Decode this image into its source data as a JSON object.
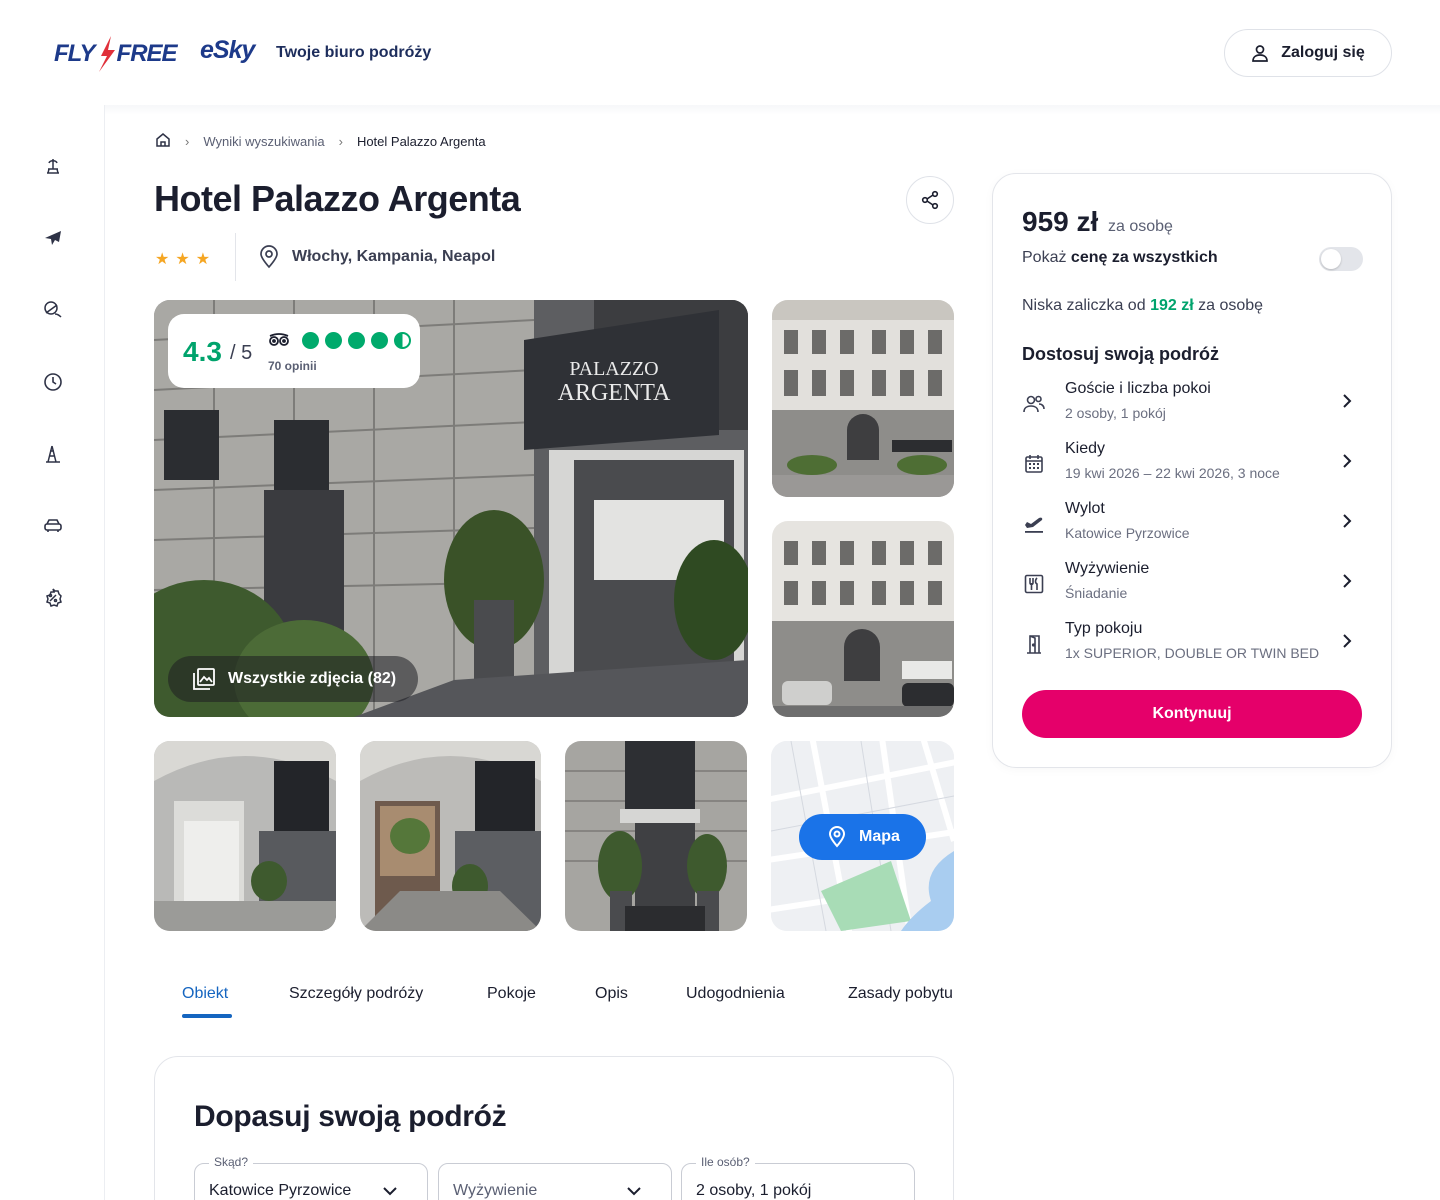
{
  "header": {
    "logo_flyfree_a": "FLY",
    "logo_flyfree_b": "FREE",
    "logo_esky": "eSky",
    "tagline": "Twoje biuro podróży",
    "login_label": "Zaloguj się"
  },
  "sidebar": {
    "items": [
      {
        "icon": "beach-icon"
      },
      {
        "icon": "plane-icon"
      },
      {
        "icon": "island-icon"
      },
      {
        "icon": "clock-icon"
      },
      {
        "icon": "landmark-icon"
      },
      {
        "icon": "car-icon"
      },
      {
        "icon": "discount-icon"
      }
    ]
  },
  "breadcrumb": {
    "items": [
      "Wyniki wyszukiwania",
      "Hotel Palazzo Argenta"
    ]
  },
  "hotel": {
    "name": "Hotel Palazzo Argenta",
    "stars": 3,
    "location": "Włochy, Kampania, Neapol",
    "rating_score": "4.3",
    "rating_of": "/ 5",
    "reviews": "70 opinii",
    "tripadvisor_bubbles": 4.5,
    "all_photos_label": "Wszystkie zdjęcia (82)",
    "map_label": "Mapa"
  },
  "tabs": [
    "Obiekt",
    "Szczegóły podróży",
    "Pokoje",
    "Opis",
    "Udogodnienia",
    "Zasady pobytu"
  ],
  "customize": {
    "title": "Dopasuj swoją podróż",
    "fields": [
      {
        "label": "Skąd?",
        "value": "Katowice Pyrzowice"
      },
      {
        "label": "",
        "value": "Wyżywienie"
      },
      {
        "label": "Ile osób?",
        "value": "2 osoby, 1 pokój"
      }
    ]
  },
  "price_card": {
    "price": "959 zł",
    "per_person": "za osobę",
    "toggle_prefix": "Pokaż",
    "toggle_bold": "cenę za wszystkich",
    "deposit_prefix": "Niska zaliczka od",
    "deposit_amount": "192 zł",
    "deposit_suffix": "za osobę",
    "adjust_title": "Dostosuj swoją podróż",
    "options": [
      {
        "title": "Goście i liczba pokoi",
        "sub": "2 osoby, 1 pokój",
        "icon": "guests-icon"
      },
      {
        "title": "Kiedy",
        "sub": "19 kwi 2026 – 22 kwi 2026, 3 noce",
        "icon": "calendar-icon"
      },
      {
        "title": "Wylot",
        "sub": "Katowice Pyrzowice",
        "icon": "departure-icon"
      },
      {
        "title": "Wyżywienie",
        "sub": "Śniadanie",
        "icon": "meal-icon"
      },
      {
        "title": "Typ pokoju",
        "sub": "1x SUPERIOR, DOUBLE OR TWIN BED",
        "icon": "door-icon"
      }
    ],
    "continue_label": "Kontynuuj"
  },
  "colors": {
    "brand_navy": "#1d3a8a",
    "accent_pink": "#e5006a",
    "green": "#00a36c",
    "blue": "#1a73e8"
  }
}
